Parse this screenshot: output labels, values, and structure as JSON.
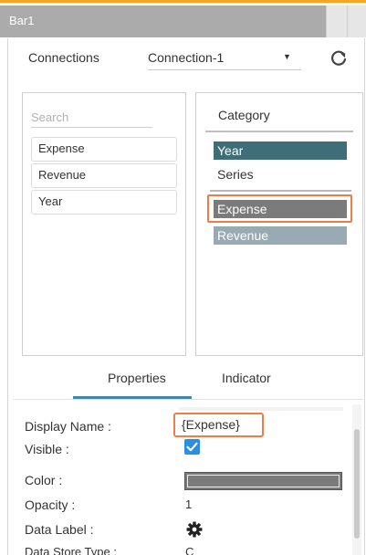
{
  "window": {
    "title": "Bar1"
  },
  "connections": {
    "label": "Connections",
    "selected": "Connection-1"
  },
  "fields": {
    "search_placeholder": "Search",
    "items": [
      "Expense",
      "Revenue",
      "Year"
    ]
  },
  "category": {
    "header": "Category",
    "year": "Year",
    "series_label": "Series",
    "series": [
      "Expense",
      "Revenue"
    ]
  },
  "tabs": {
    "properties": "Properties",
    "indicator": "Indicator"
  },
  "properties": {
    "display_name_label": "Display Name :",
    "display_name_value": "{Expense}",
    "visible_label": "Visible :",
    "visible_checked": true,
    "color_label": "Color :",
    "color_value": "#7a7a7a",
    "opacity_label": "Opacity :",
    "opacity_value": "1",
    "data_label_label": "Data Label :",
    "data_store_type_label": "Data Store Type :",
    "data_store_type_value": "C"
  },
  "colors": {
    "accent_orange": "#ef7d48",
    "top_accent": "#f5a623",
    "year_bg": "#3f6e78",
    "expense_bg": "#7b7b7b",
    "revenue_bg": "#98aab2",
    "tab_underline": "#3e86b4",
    "checkbox": "#2b8ee0"
  },
  "icons": {
    "refresh": "refresh-icon",
    "caret": "caret-down-icon",
    "gear": "gear-icon",
    "check": "check-icon"
  }
}
